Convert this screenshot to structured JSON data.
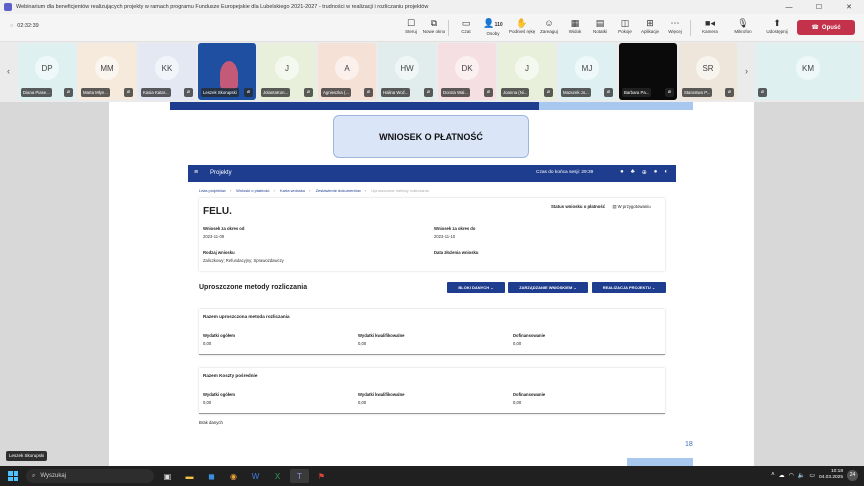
{
  "window": {
    "title": "Webinarium dla beneficjentów realizujących projekty w ramach programu Fundusze Europejskie dla Lubelskiego 2021-2027 - trudności w realizacji i rozliczaniu projektów",
    "minimize": "—",
    "maximize": "☐",
    "close": "✕"
  },
  "meeting": {
    "timer": "02:32:39",
    "toolbar": [
      {
        "id": "chat",
        "label": "Czat",
        "icon": "chat-icon",
        "glyph": "▭"
      },
      {
        "id": "people",
        "label": "Osoby",
        "icon": "people-icon",
        "glyph": "👤",
        "count": "110"
      },
      {
        "id": "raise",
        "label": "Podnieś rękę",
        "icon": "hand-icon",
        "glyph": "✋"
      },
      {
        "id": "react",
        "label": "Zareaguj",
        "icon": "smile-icon",
        "glyph": "☺"
      },
      {
        "id": "view",
        "label": "Widok",
        "icon": "grid-icon",
        "glyph": "▦"
      },
      {
        "id": "notes",
        "label": "Notatki",
        "icon": "notes-icon",
        "glyph": "▤"
      },
      {
        "id": "rooms",
        "label": "Pokoje",
        "icon": "rooms-icon",
        "glyph": "◫"
      },
      {
        "id": "apps",
        "label": "Aplikacje",
        "icon": "plus-icon",
        "glyph": "⊞"
      },
      {
        "id": "more",
        "label": "Więcej",
        "icon": "more-icon",
        "glyph": "⋯"
      }
    ],
    "left_buttons": [
      {
        "id": "steer",
        "label": "Steruj",
        "icon": "steer-icon",
        "glyph": "☐"
      },
      {
        "id": "newwin",
        "label": "Nowe okno",
        "icon": "window-icon",
        "glyph": "⧉"
      }
    ],
    "camera_label": "Kamera",
    "mic_label": "Mikrofon",
    "share_label": "Udostępnij",
    "leave_label": "Opuść",
    "participants": [
      {
        "initials": "DP",
        "name": "Diana Piase...",
        "color": "#dff0f0"
      },
      {
        "initials": "MM",
        "name": "Marta Młyn...",
        "color": "#f5eadc"
      },
      {
        "initials": "KK",
        "name": "Kasia Katar...",
        "color": "#e3e8f3"
      },
      {
        "initials": "",
        "name": "Leszek Skorupski",
        "color": "#1f4fa0"
      },
      {
        "initials": "J",
        "name": "JolantaKon...",
        "color": "#e8f0dc"
      },
      {
        "initials": "A",
        "name": "Agnieszka (...",
        "color": "#f6e1d7"
      },
      {
        "initials": "HW",
        "name": "Halina Woź...",
        "color": "#e1ecec"
      },
      {
        "initials": "DK",
        "name": "Dorota Wal...",
        "color": "#f5dfe2"
      },
      {
        "initials": "J",
        "name": "Joanna (Ni...",
        "color": "#e8f0dc"
      },
      {
        "initials": "MJ",
        "name": "Mazurek Jo...",
        "color": "#dff0f3"
      },
      {
        "initials": "",
        "name": "Barbara Pa...",
        "color": "#0a0a0a"
      },
      {
        "initials": "SR",
        "name": "Starostwo P...",
        "color": "#eee6da"
      },
      {
        "initials": "KM",
        "name": "",
        "color": "#dff0f0"
      }
    ],
    "presenter": "Leszek Skorupski"
  },
  "slide": {
    "title": "WNIOSEK O PŁATNOŚĆ",
    "page_number": "18"
  },
  "app": {
    "brand": "Projekty",
    "session": "Czas do końca sesji: 29:39",
    "breadcrumbs": [
      "Lista projektów",
      "Wnioski o płatność",
      "Karta wniosku",
      "Zestawienie dokumentów",
      "Uproszczone metody rozliczania"
    ],
    "project": "FELU.",
    "status_label": "Status wniosku o płatność",
    "status_value": "W przygotowaniu",
    "fields": [
      {
        "key": "Wniosek za okres od",
        "value": "2023-11-09"
      },
      {
        "key": "Wniosek za okres do",
        "value": "2023-11-10"
      },
      {
        "key": "Rodzaj wniosku",
        "value": "Zaliczkowy; Refundacyjny; Sprawozdawczy"
      },
      {
        "key": "Data złożenia wniosku",
        "value": ""
      }
    ],
    "section_title": "Uproszczone metody rozliczania",
    "buttons": [
      "BLOKI DANYCH ⌄",
      "ZARZĄDZANIE WNIOSKIEM ⌄",
      "REALIZACJA PROJEKTU ⌄"
    ],
    "cards": [
      {
        "title": "Razem uproszczona metoda rozliczania",
        "columns": [
          {
            "key": "Wydatki ogółem",
            "value": "0,00"
          },
          {
            "key": "Wydatki kwalifikowalne",
            "value": "0,00"
          },
          {
            "key": "Dofinansowanie",
            "value": "0,00"
          }
        ]
      },
      {
        "title": "Razem Koszty pośrednie",
        "columns": [
          {
            "key": "Wydatki ogółem",
            "value": "0,00"
          },
          {
            "key": "Wydatki kwalifikowalne",
            "value": "0,00"
          },
          {
            "key": "Dofinansowanie",
            "value": "0,00"
          }
        ]
      }
    ],
    "note": "Brak danych"
  },
  "taskbar": {
    "search_placeholder": "Wyszukaj",
    "time": "10:18",
    "date": "04.03.2025",
    "notification_count": "24"
  }
}
